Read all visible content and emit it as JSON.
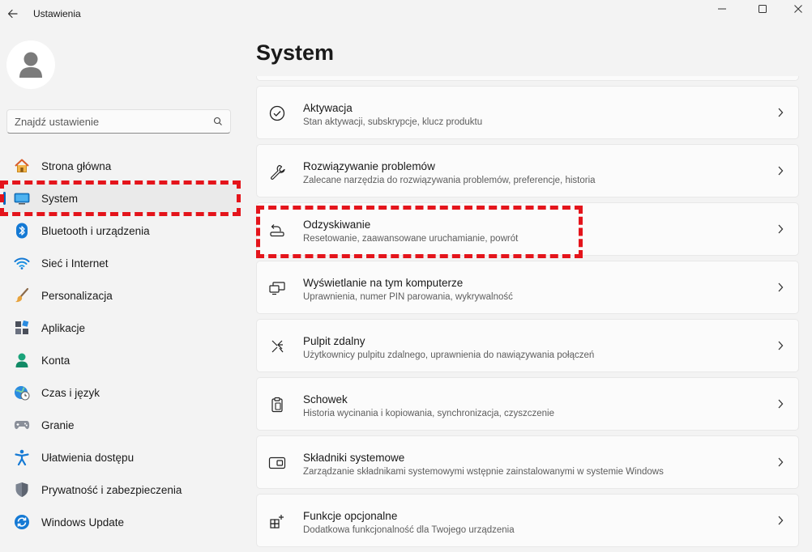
{
  "window": {
    "title": "Ustawienia"
  },
  "search": {
    "placeholder": "Znajdź ustawienie"
  },
  "sidebar": {
    "items": [
      {
        "label": "Strona główna"
      },
      {
        "label": "System"
      },
      {
        "label": "Bluetooth i urządzenia"
      },
      {
        "label": "Sieć i Internet"
      },
      {
        "label": "Personalizacja"
      },
      {
        "label": "Aplikacje"
      },
      {
        "label": "Konta"
      },
      {
        "label": "Czas i język"
      },
      {
        "label": "Granie"
      },
      {
        "label": "Ułatwienia dostępu"
      },
      {
        "label": "Prywatność i zabezpieczenia"
      },
      {
        "label": "Windows Update"
      }
    ],
    "selected_index": 1
  },
  "main": {
    "title": "System",
    "cards": [
      {
        "title": "Aktywacja",
        "subtitle": "Stan aktywacji, subskrypcje, klucz produktu"
      },
      {
        "title": "Rozwiązywanie problemów",
        "subtitle": "Zalecane narzędzia do rozwiązywania problemów, preferencje, historia"
      },
      {
        "title": "Odzyskiwanie",
        "subtitle": "Resetowanie, zaawansowane uruchamianie, powrót"
      },
      {
        "title": "Wyświetlanie na tym komputerze",
        "subtitle": "Uprawnienia, numer PIN parowania, wykrywalność"
      },
      {
        "title": "Pulpit zdalny",
        "subtitle": "Użytkownicy pulpitu zdalnego, uprawnienia do nawiązywania połączeń"
      },
      {
        "title": "Schowek",
        "subtitle": "Historia wycinania i kopiowania, synchronizacja, czyszczenie"
      },
      {
        "title": "Składniki systemowe",
        "subtitle": "Zarządzanie składnikami systemowymi wstępnie zainstalowanymi w systemie Windows"
      },
      {
        "title": "Funkcje opcjonalne",
        "subtitle": "Dodatkowa funkcjonalność dla Twojego urządzenia"
      }
    ]
  },
  "colors": {
    "accent": "#0067c0",
    "highlight": "#e4141b"
  }
}
